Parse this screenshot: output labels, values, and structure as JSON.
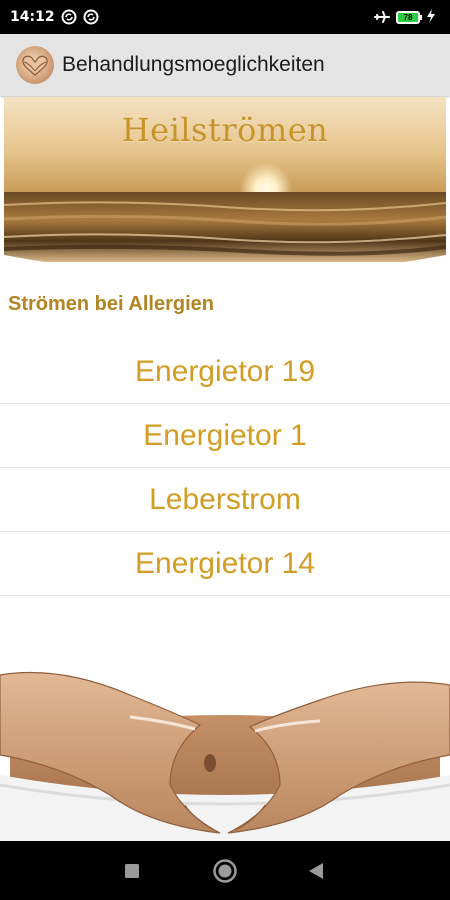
{
  "status_bar": {
    "time": "14:12",
    "left_icons": [
      "sync-icon",
      "sync-icon"
    ],
    "right_icons": [
      "airplane-mode-icon",
      "battery-icon",
      "charging-icon"
    ],
    "battery_level": "78"
  },
  "app_bar": {
    "icon": "heart-hands-logo-icon",
    "title": "Behandlungsmoeglichkeiten"
  },
  "banner": {
    "title": "Heilströmen"
  },
  "section": {
    "title": "Strömen bei Allergien"
  },
  "items": [
    {
      "label": "Energietor 19"
    },
    {
      "label": "Energietor 1"
    },
    {
      "label": "Leberstrom"
    },
    {
      "label": "Energietor 14"
    }
  ],
  "nav_bar": {
    "buttons": [
      "recents-square-icon",
      "home-circle-icon",
      "back-triangle-icon"
    ]
  },
  "colors": {
    "accent": "#d29d22",
    "section_title": "#b28422",
    "app_bar_bg": "#e4e4e4"
  }
}
